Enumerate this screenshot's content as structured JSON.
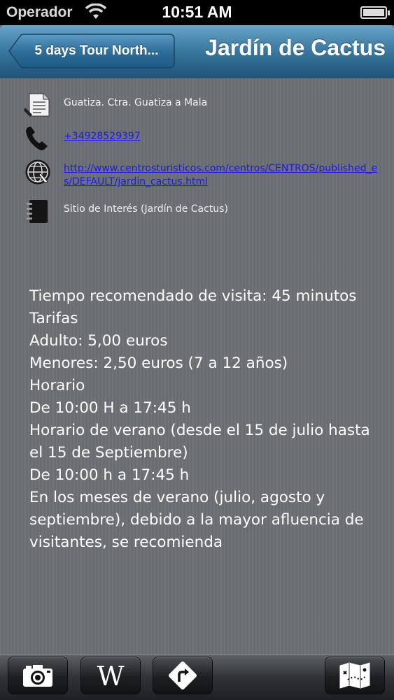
{
  "status_bar": {
    "carrier": "Operador",
    "time": "10:51 AM"
  },
  "nav": {
    "back_label": "5 days Tour North...",
    "title": "Jardín de Cactus"
  },
  "info": {
    "address": "Guatiza. Ctra. Guatiza a Mala",
    "phone": "+34928529397",
    "website": "http://www.centrosturisticos.com/centros/CENTROS/published_es/DEFAULT/jardin_cactus.html",
    "category": "Sitio de Interés (Jardín de Cactus)"
  },
  "description": "Tiempo recomendado de visita: 45 minutos\nTarifas\nAdulto:    5,00 euros\nMenores: 2,50 euros (7 a 12 años)\nHorario\nDe 10:00 H a 17:45 h\nHorario de verano (desde el 15 de julio hasta el 15 de Septiembre)\nDe 10:00 h a 17:45 h\nEn los meses de verano (julio, agosto y septiembre), debido a la mayor afluencia de visitantes, se recomienda",
  "toolbar": {
    "icons": [
      "camera-icon",
      "wikipedia-icon",
      "directions-icon",
      "map-icon"
    ]
  },
  "colors": {
    "nav_blue": "#3f7ea6",
    "link": "#1a1aee",
    "background": "#6c7075"
  }
}
